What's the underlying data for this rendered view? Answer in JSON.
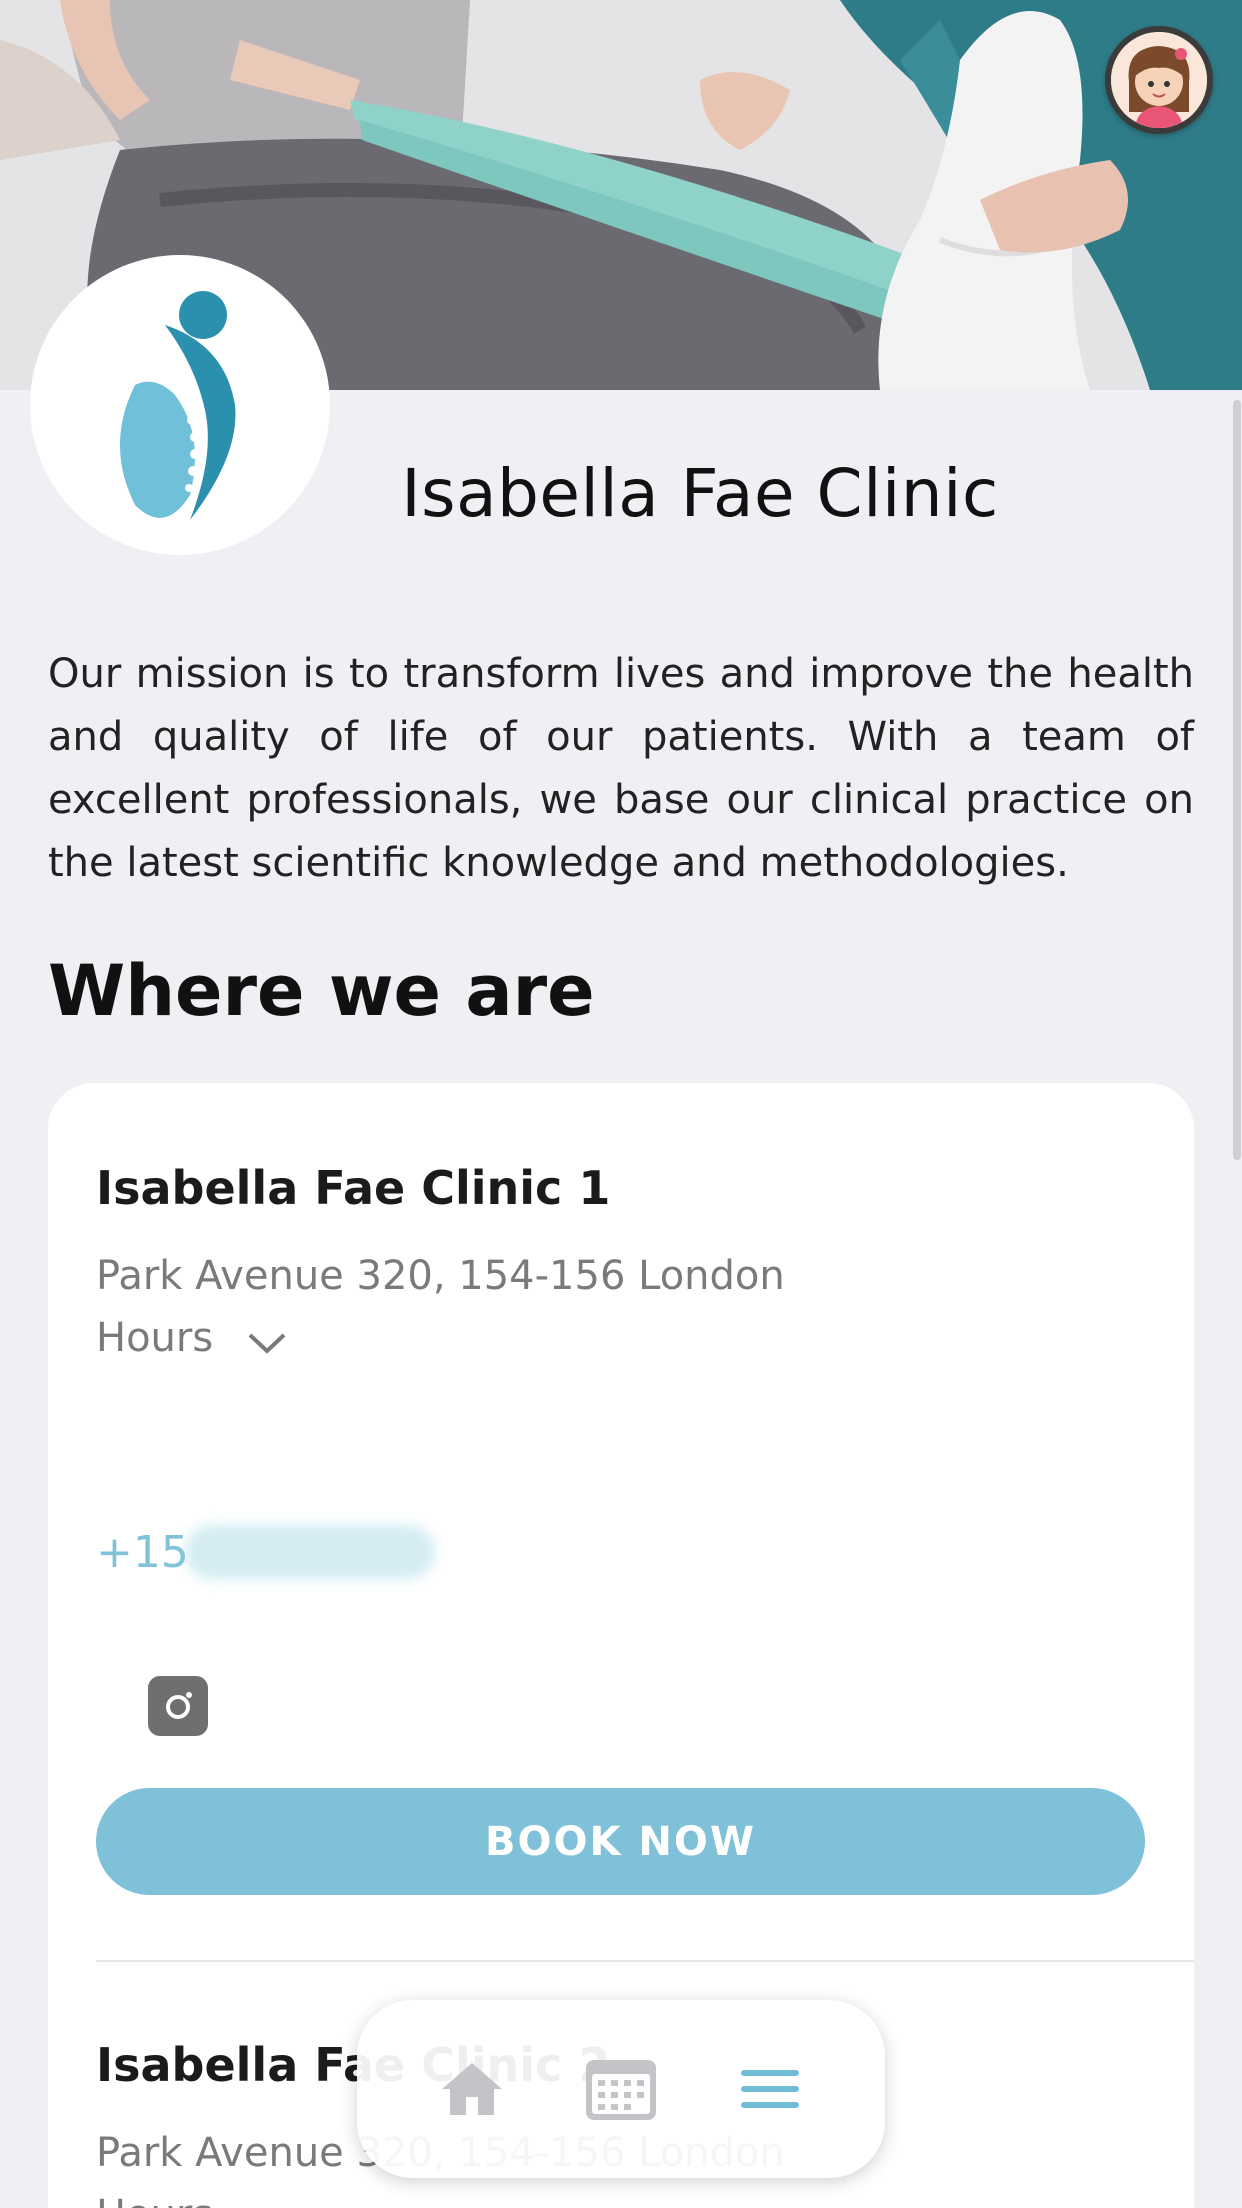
{
  "hero": {
    "avatar_icon": "user-avatar-icon"
  },
  "clinic": {
    "name": "Isabella Fae Clinic",
    "logo_icon": "spine-logo-icon",
    "mission": "Our mission is to transform lives and improve the health and quality of life of our patients. With a team of excellent professionals, we base our clinical practice on the latest scientific knowledge and methodologies."
  },
  "where_we_are": {
    "title": "Where we are",
    "locations": [
      {
        "name": "Isabella Fae Clinic 1",
        "address": "Park Avenue 320, 154-156 London",
        "hours_label": "Hours",
        "phone_prefix": "+15",
        "book_label": "BOOK NOW"
      },
      {
        "name": "Isabella Fae Clinic 2",
        "address": "Park Avenue 320, 154-156 London",
        "hours_label": "Hours"
      }
    ]
  },
  "tabbar": {
    "items": [
      "home-icon",
      "calendar-icon",
      "menu-icon"
    ]
  },
  "colors": {
    "accent": "#7fc1d8",
    "background": "#f0eff4",
    "card": "#ffffff"
  }
}
